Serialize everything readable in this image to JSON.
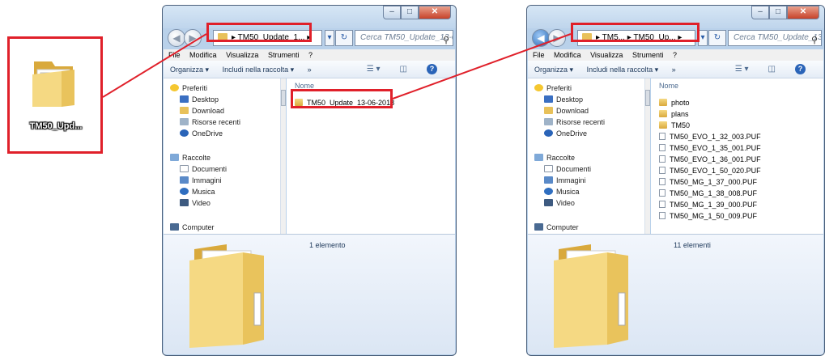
{
  "desktop_icon": {
    "label": "TM50_Upd..."
  },
  "window1": {
    "path_segments": [
      "TM50_Update_1..."
    ],
    "search_placeholder": "Cerca TM50_Update_13-0...",
    "menu": [
      "File",
      "Modifica",
      "Visualizza",
      "Strumenti",
      "?"
    ],
    "toolbar": {
      "organize": "Organizza ▾",
      "include": "Includi nella raccolta ▾",
      "more": "»"
    },
    "nav": {
      "favorites": "Preferiti",
      "fav_items": [
        "Desktop",
        "Download",
        "Risorse recenti",
        "OneDrive"
      ],
      "libraries": "Raccolte",
      "lib_items": [
        "Documenti",
        "Immagini",
        "Musica",
        "Video"
      ],
      "computer": "Computer"
    },
    "column_name": "Nome",
    "items": [
      {
        "name": "TM50_Update_13-06-2018",
        "type": "folder"
      }
    ],
    "count": "1 elemento"
  },
  "window2": {
    "path_segments": [
      "TM5...",
      "TM50_Up..."
    ],
    "search_placeholder": "Cerca TM50_Update_13-0...",
    "menu": [
      "File",
      "Modifica",
      "Visualizza",
      "Strumenti",
      "?"
    ],
    "toolbar": {
      "organize": "Organizza ▾",
      "include": "Includi nella raccolta ▾",
      "more": "»"
    },
    "nav": {
      "favorites": "Preferiti",
      "fav_items": [
        "Desktop",
        "Download",
        "Risorse recenti",
        "OneDrive"
      ],
      "libraries": "Raccolte",
      "lib_items": [
        "Documenti",
        "Immagini",
        "Musica",
        "Video"
      ],
      "computer": "Computer"
    },
    "column_name": "Nome",
    "items": [
      {
        "name": "photo",
        "type": "folder"
      },
      {
        "name": "plans",
        "type": "folder"
      },
      {
        "name": "TM50",
        "type": "folder"
      },
      {
        "name": "TM50_EVO_1_32_003.PUF",
        "type": "file"
      },
      {
        "name": "TM50_EVO_1_35_001.PUF",
        "type": "file"
      },
      {
        "name": "TM50_EVO_1_36_001.PUF",
        "type": "file"
      },
      {
        "name": "TM50_EVO_1_50_020.PUF",
        "type": "file"
      },
      {
        "name": "TM50_MG_1_37_000.PUF",
        "type": "file"
      },
      {
        "name": "TM50_MG_1_38_008.PUF",
        "type": "file"
      },
      {
        "name": "TM50_MG_1_39_000.PUF",
        "type": "file"
      },
      {
        "name": "TM50_MG_1_50_009.PUF",
        "type": "file"
      }
    ],
    "count": "11 elementi"
  },
  "colors": {
    "highlight": "#e0202a",
    "folder": "#e8c15a"
  }
}
